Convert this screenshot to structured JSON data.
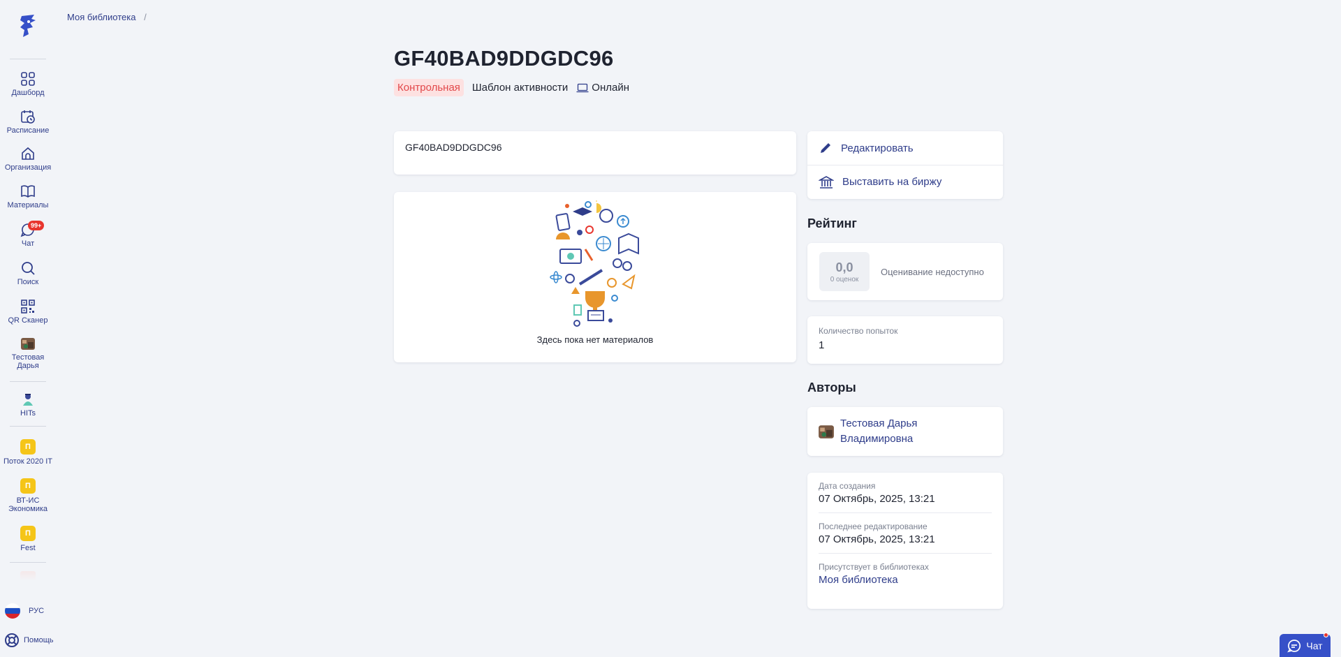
{
  "breadcrumb": {
    "item": "Моя библиотека",
    "sep": "/"
  },
  "sidebar": {
    "items": [
      {
        "label": "Дашборд"
      },
      {
        "label": "Расписание"
      },
      {
        "label": "Организация"
      },
      {
        "label": "Материалы"
      },
      {
        "label": "Чат",
        "badge": "99+"
      },
      {
        "label": "Поиск"
      },
      {
        "label": "QR Сканер"
      },
      {
        "label": "Тестовая Дарья"
      },
      {
        "label": "HITs"
      },
      {
        "label": "Поток 2020 IT",
        "initial": "П"
      },
      {
        "label": "ВТ-ИС Экономика",
        "initial": "П"
      },
      {
        "label": "Fest",
        "initial": "П"
      }
    ],
    "language": "РУС",
    "help": "Помощь"
  },
  "header": {
    "title": "GF40BAD9DDGDC96",
    "tag_type": "Контрольная",
    "tag_template": "Шаблон активности",
    "tag_mode": "Онлайн"
  },
  "description": "GF40BAD9DDGDC96",
  "materials": {
    "empty_text": "Здесь пока нет материалов"
  },
  "actions": {
    "edit": "Редактировать",
    "publish": "Выставить на биржу"
  },
  "rating": {
    "title": "Рейтинг",
    "value": "0,0",
    "count": "0 оценок",
    "status": "Оценивание недоступно"
  },
  "attempts": {
    "label": "Количество попыток",
    "value": "1"
  },
  "authors": {
    "title": "Авторы",
    "name": "Тестовая Дарья Владимировна"
  },
  "meta": {
    "created_label": "Дата создания",
    "created_value": "07 Октябрь, 2025, 13:21",
    "edited_label": "Последнее редактирование",
    "edited_value": "07 Октябрь, 2025, 13:21",
    "libraries_label": "Присутствует в библиотеках",
    "libraries_value": "Моя библиотека"
  },
  "chat_button": "Чат",
  "colors": {
    "accent": "#2f3d8a",
    "tag_red": "#e2484a",
    "tag_red_bg": "#fde1e1",
    "badge": "#e8352e",
    "group_yellow": "#f5c518",
    "chat_btn": "#3650c8"
  }
}
